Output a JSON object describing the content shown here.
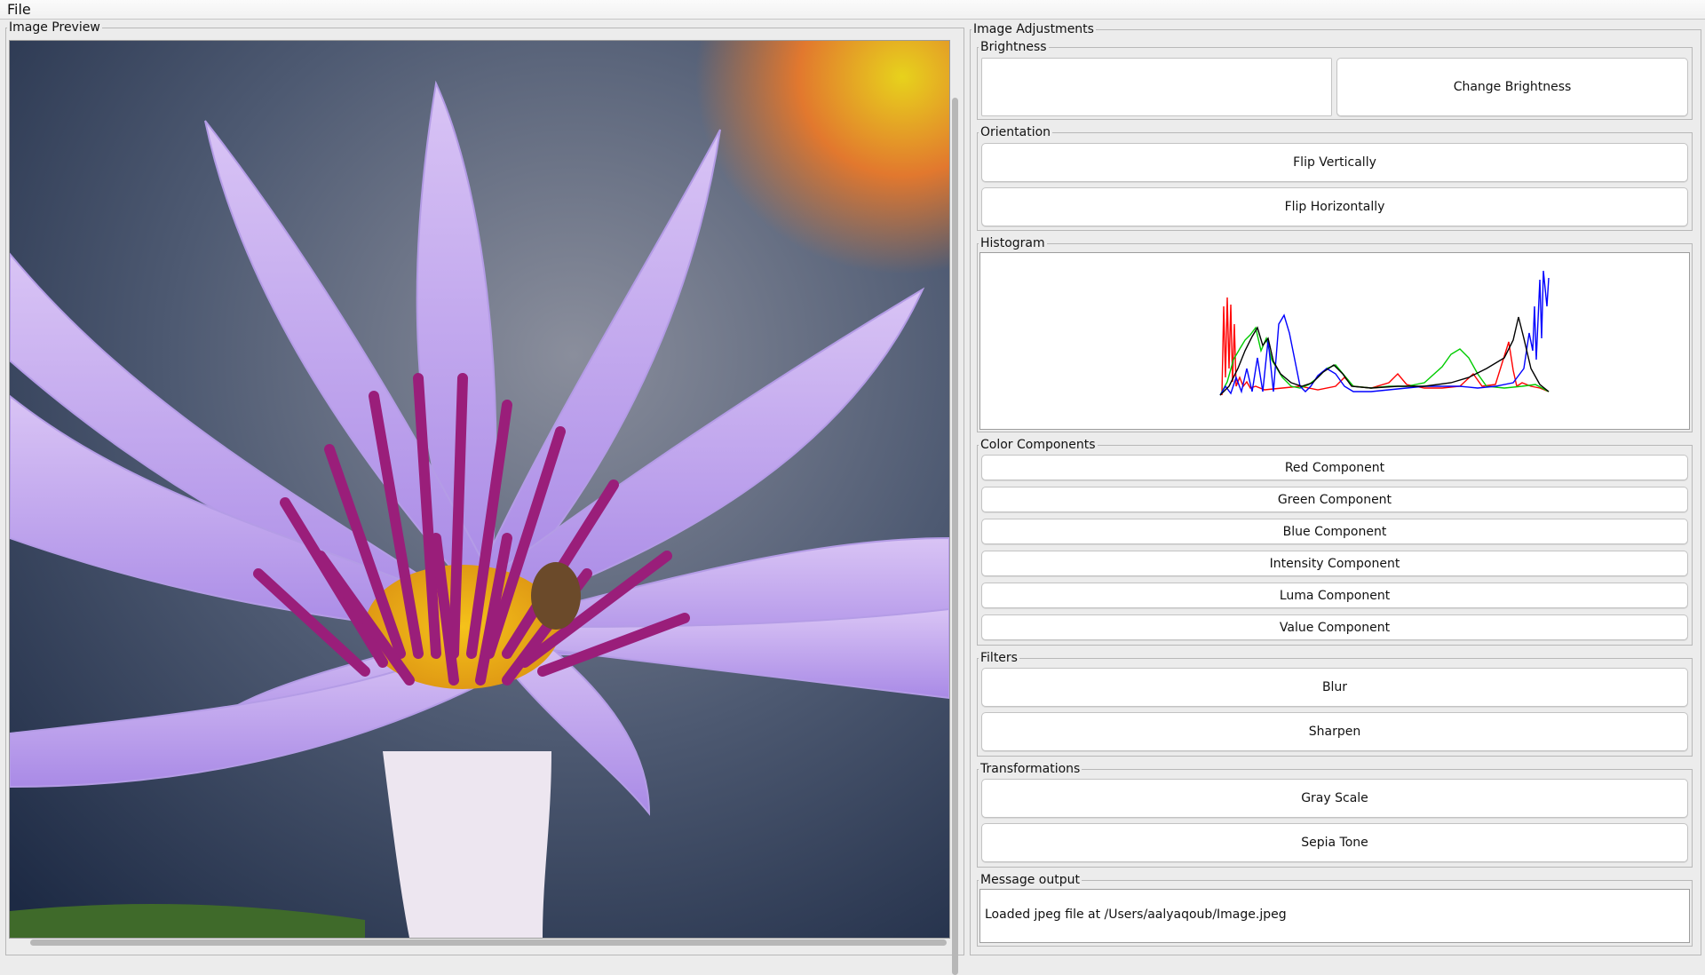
{
  "menu": {
    "file_label": "File"
  },
  "preview": {
    "title": "Image Preview"
  },
  "adjustments": {
    "title": "Image Adjustments",
    "brightness": {
      "title": "Brightness",
      "button": "Change Brightness"
    },
    "orientation": {
      "title": "Orientation",
      "flip_vertical": "Flip Vertically",
      "flip_horizontal": "Flip Horizontally"
    },
    "histogram": {
      "title": "Histogram"
    },
    "color_components": {
      "title": "Color Components",
      "buttons": [
        "Red Component",
        "Green Component",
        "Blue Component",
        "Intensity Component",
        "Luma Component",
        "Value Component"
      ]
    },
    "filters": {
      "title": "Filters",
      "blur": "Blur",
      "sharpen": "Sharpen"
    },
    "transformations": {
      "title": "Transformations",
      "gray": "Gray Scale",
      "sepia": "Sepia Tone"
    },
    "message": {
      "title": "Message output",
      "text": "Loaded jpeg file at /Users/aalyaqoub/Image.jpeg"
    }
  },
  "histogram_colors": {
    "red": "#ff0000",
    "green": "#00cc00",
    "blue": "#0000ff",
    "intensity": "#000000"
  }
}
